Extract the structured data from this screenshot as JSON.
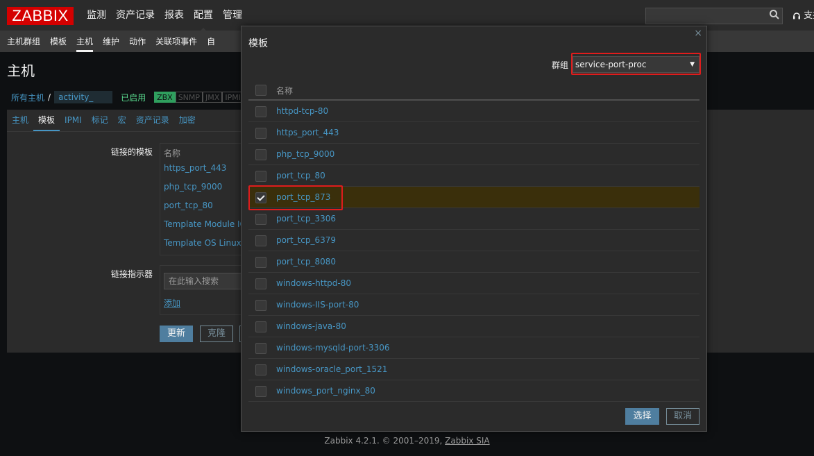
{
  "header": {
    "logo": "ZABBIX",
    "nav": [
      "监测",
      "资产记录",
      "报表",
      "配置",
      "管理"
    ],
    "support_label": "支持"
  },
  "subnav": [
    "主机群组",
    "模板",
    "主机",
    "维护",
    "动作",
    "关联项事件",
    "自"
  ],
  "page_title": "主机",
  "breadcrumb": {
    "all_hosts": "所有主机",
    "host": "activity_",
    "status": "已启用",
    "tags": [
      "ZBX",
      "SNMP",
      "JMX",
      "IPMI"
    ]
  },
  "form_tabs": [
    "主机",
    "模板",
    "IPMI",
    "标记",
    "宏",
    "资产记录",
    "加密"
  ],
  "form": {
    "linked_templates_label": "链接的模板",
    "name_header": "名称",
    "linked_templates": [
      "https_port_443",
      "php_tcp_9000",
      "port_tcp_80",
      "Template Module ICM",
      "Template OS Linux"
    ],
    "link_indicator_label": "链接指示器",
    "search_placeholder": "在此输入搜索",
    "add_link": "添加",
    "update_button": "更新",
    "clone_button": "克隆"
  },
  "modal": {
    "title": "模板",
    "close": "×",
    "group_label": "群组",
    "group_value": "service-port-proc",
    "name_header": "名称",
    "rows": [
      {
        "name": "httpd-tcp-80",
        "checked": false
      },
      {
        "name": "https_port_443",
        "checked": false
      },
      {
        "name": "php_tcp_9000",
        "checked": false
      },
      {
        "name": "port_tcp_80",
        "checked": false
      },
      {
        "name": "port_tcp_873",
        "checked": true
      },
      {
        "name": "port_tcp_3306",
        "checked": false
      },
      {
        "name": "port_tcp_6379",
        "checked": false
      },
      {
        "name": "port_tcp_8080",
        "checked": false
      },
      {
        "name": "windows-httpd-80",
        "checked": false
      },
      {
        "name": "windows-IIS-port-80",
        "checked": false
      },
      {
        "name": "windows-java-80",
        "checked": false
      },
      {
        "name": "windows-mysqld-port-3306",
        "checked": false
      },
      {
        "name": "windows-oracle_port_1521",
        "checked": false
      },
      {
        "name": "windows_port_nginx_80",
        "checked": false
      }
    ],
    "select_button": "选择",
    "cancel_button": "取消"
  },
  "footer": {
    "text": "Zabbix 4.2.1. © 2001–2019, ",
    "link": "Zabbix SIA"
  }
}
